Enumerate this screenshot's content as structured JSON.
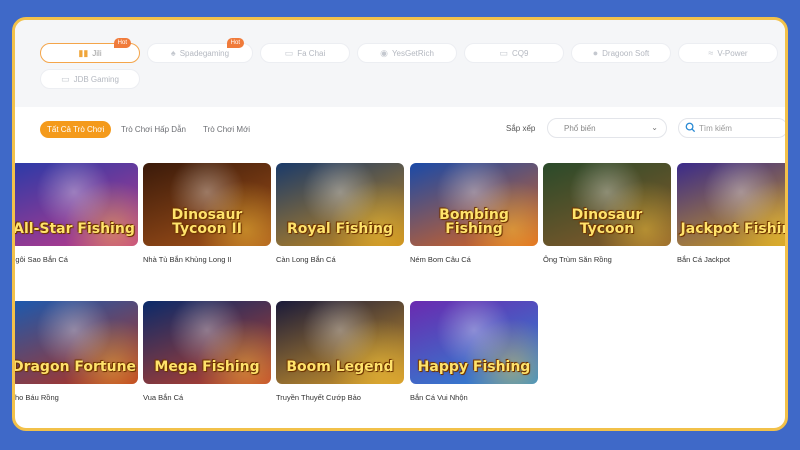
{
  "providers": [
    {
      "label": "Jili",
      "badge": "Hot",
      "active": true,
      "icon": "chart-icon"
    },
    {
      "label": "Spadegaming",
      "badge": "Hot",
      "active": false,
      "icon": "spade-icon"
    },
    {
      "label": "Fa Chai",
      "badge": "",
      "active": false,
      "icon": "fc-logo-icon"
    },
    {
      "label": "YesGetRich",
      "badge": "",
      "active": false,
      "icon": "eye-icon"
    },
    {
      "label": "CQ9",
      "badge": "",
      "active": false,
      "icon": "cq9-logo-icon"
    },
    {
      "label": "Dragoon Soft",
      "badge": "",
      "active": false,
      "icon": "dragon-icon"
    },
    {
      "label": "V-Power",
      "badge": "",
      "active": false,
      "icon": "wings-icon"
    },
    {
      "label": "JDB Gaming",
      "badge": "",
      "active": false,
      "icon": "jdb-logo-icon"
    }
  ],
  "filters": {
    "tabs": [
      "Tất Cả Trò Chơi",
      "Trò Chơi Hấp Dẫn",
      "Trò Chơi Mới"
    ],
    "sort_label": "Sắp xếp",
    "sort_value": "Phổ biến",
    "search_placeholder": "Tìm kiếm"
  },
  "games": [
    {
      "title": "Ngôi Sao Bắn Cá",
      "logo": "All-Star Fishing",
      "colors": [
        "#2a3aa8",
        "#c23a8a"
      ]
    },
    {
      "title": "Nhà Tù Bắn Khủng Long II",
      "logo": "Dinosaur Tycoon II",
      "colors": [
        "#3a1a0a",
        "#a8541a"
      ]
    },
    {
      "title": "Càn Long Bắn Cá",
      "logo": "Royal Fishing",
      "colors": [
        "#1a3a6a",
        "#c98a1a"
      ]
    },
    {
      "title": "Ném Bom Câu Cá",
      "logo": "Bombing Fishing",
      "colors": [
        "#1a4aa8",
        "#e0641a"
      ]
    },
    {
      "title": "Ông Trùm Săn Rồng",
      "logo": "Dinosaur Tycoon",
      "colors": [
        "#2a4a2a",
        "#8a5a2a"
      ]
    },
    {
      "title": "Bắn Cá Jackpot",
      "logo": "Jackpot Fishing",
      "colors": [
        "#3a2a8a",
        "#d4a21a"
      ]
    },
    {
      "title": "Kho Báu Rồng",
      "logo": "Dragon Fortune",
      "colors": [
        "#1a5ab0",
        "#b8301a"
      ]
    },
    {
      "title": "Vua Bắn Cá",
      "logo": "Mega Fishing",
      "colors": [
        "#0a2a6a",
        "#c0402a"
      ]
    },
    {
      "title": "Truyền Thuyết Cướp Bảo",
      "logo": "Boom Legend",
      "colors": [
        "#1a1a3a",
        "#d49a2a"
      ]
    },
    {
      "title": "Bắn Cá Vui Nhộn",
      "logo": "Happy Fishing",
      "colors": [
        "#6a2ab0",
        "#2a8ad4"
      ]
    }
  ],
  "colors": {
    "accent": "#f49a1b",
    "frame": "#f2c14a",
    "background": "#3f69c8"
  }
}
